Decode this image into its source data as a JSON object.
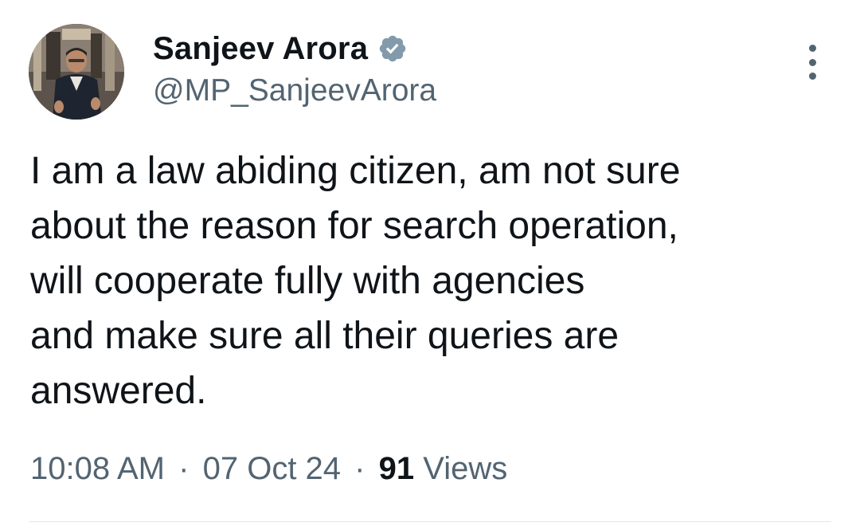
{
  "author": {
    "display_name": "Sanjeev Arora",
    "handle": "@MP_SanjeevArora",
    "verified_icon": "verified-badge-icon",
    "avatar_icon": "profile-photo"
  },
  "tweet": {
    "lines": [
      "I am a law abiding citizen, am not sure",
      "about the reason for search operation,",
      "will cooperate fully with agencies",
      "and make sure all their queries are",
      "answered."
    ]
  },
  "meta": {
    "time": "10:08 AM",
    "separator": "·",
    "date": "07 Oct 24",
    "views_count": "91",
    "views_label": "Views"
  },
  "colors": {
    "text": "#0f1419",
    "secondary": "#536471",
    "verified": "#829aab",
    "divider": "#e1e8ed"
  },
  "more_icon": "more-options-icon"
}
